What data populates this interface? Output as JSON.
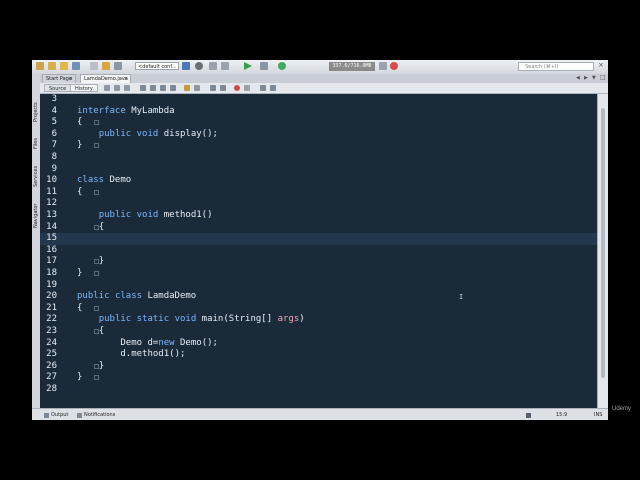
{
  "toolbar": {
    "config_value": "<default conf...",
    "memory": "337.6/716.0MB",
    "search_placeholder": "Search (⌘+I)"
  },
  "tabs": [
    {
      "label": "Start Page",
      "active": false
    },
    {
      "label": "LamdaDemo.java",
      "active": true
    }
  ],
  "editor_toolbar": {
    "source_label": "Source",
    "history_label": "History"
  },
  "side_tabs": [
    "Projects",
    "Files",
    "Services",
    "Navigator"
  ],
  "editor": {
    "current_line": 15,
    "lines": [
      {
        "n": "3",
        "t": ""
      },
      {
        "n": "4",
        "t": "interface MyLambda"
      },
      {
        "n": "5",
        "t": "{"
      },
      {
        "n": "6",
        "t": "    public void display();"
      },
      {
        "n": "7",
        "t": "}"
      },
      {
        "n": "8",
        "t": ""
      },
      {
        "n": "9",
        "t": ""
      },
      {
        "n": "10",
        "t": "class Demo"
      },
      {
        "n": "11",
        "t": "{"
      },
      {
        "n": "12",
        "t": ""
      },
      {
        "n": "13",
        "t": "    public void method1()"
      },
      {
        "n": "14",
        "t": "    {"
      },
      {
        "n": "15",
        "t": ""
      },
      {
        "n": "16",
        "t": ""
      },
      {
        "n": "17",
        "t": "    }"
      },
      {
        "n": "18",
        "t": "}"
      },
      {
        "n": "19",
        "t": ""
      },
      {
        "n": "20",
        "t": "public class LamdaDemo"
      },
      {
        "n": "21",
        "t": "{"
      },
      {
        "n": "22",
        "t": "    public static void main(String[] args)"
      },
      {
        "n": "23",
        "t": "    {"
      },
      {
        "n": "24",
        "t": "        Demo d=new Demo();"
      },
      {
        "n": "25",
        "t": "        d.method1();"
      },
      {
        "n": "26",
        "t": "    }"
      },
      {
        "n": "27",
        "t": "}"
      },
      {
        "n": "28",
        "t": ""
      }
    ]
  },
  "status": {
    "output_label": "Output",
    "notifications_label": "Notifications",
    "position": "15:9",
    "mode": "INS"
  },
  "watermark": "Udemy",
  "colors": {
    "editor_bg": "#1b2a39",
    "keyword": "#79b8ff",
    "parameter": "#f2a6b5",
    "text": "#e7edf3"
  }
}
